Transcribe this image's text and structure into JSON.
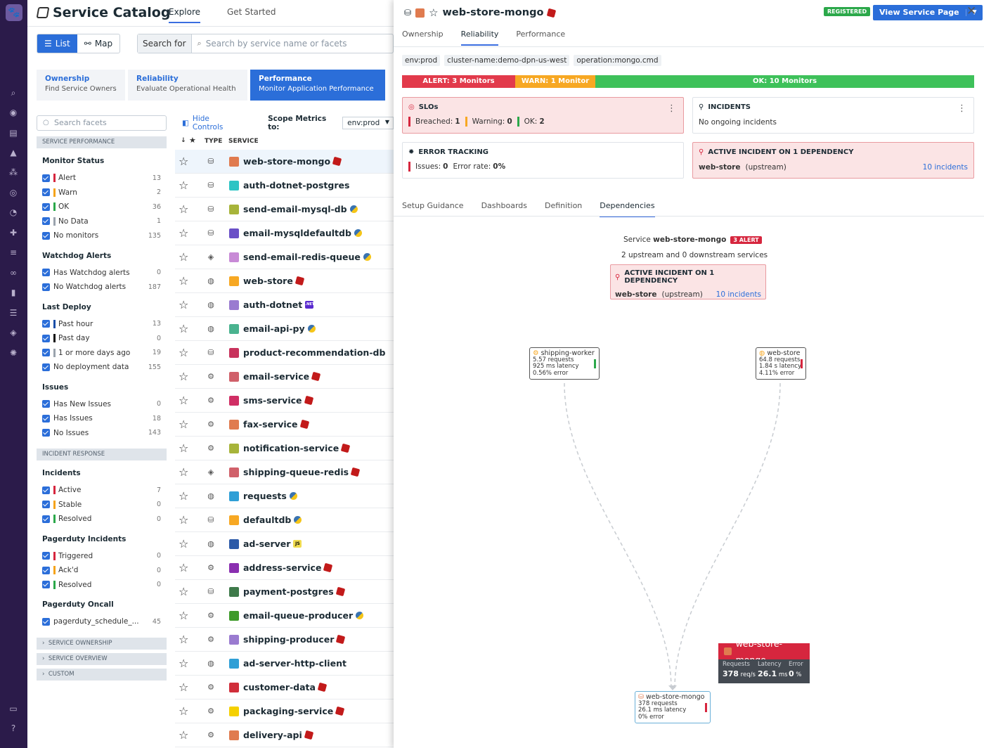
{
  "app": {
    "title": "Service Catalog",
    "tabs": [
      "Explore",
      "Get Started"
    ]
  },
  "view": {
    "list": "List",
    "map": "Map",
    "search_label": "Search for",
    "search_placeholder": "Search by service name or facets"
  },
  "cards": [
    {
      "title": "Ownership",
      "subtitle": "Find Service Owners"
    },
    {
      "title": "Reliability",
      "subtitle": "Evaluate Operational Health"
    },
    {
      "title": "Performance",
      "subtitle": "Monitor Application Performance"
    }
  ],
  "facets": {
    "search_placeholder": "Search facets",
    "section1": "Service Performance",
    "groups": [
      {
        "name": "Monitor Status",
        "items": [
          {
            "label": "Alert",
            "count": "13",
            "color": "#d6263e"
          },
          {
            "label": "Warn",
            "count": "2",
            "color": "#f5a31a"
          },
          {
            "label": "OK",
            "count": "36",
            "color": "#2ba84a"
          },
          {
            "label": "No Data",
            "count": "1",
            "color": "#9aa3ad"
          },
          {
            "label": "No monitors",
            "count": "135",
            "color": ""
          }
        ]
      },
      {
        "name": "Watchdog Alerts",
        "items": [
          {
            "label": "Has Watchdog alerts",
            "count": "0",
            "color": ""
          },
          {
            "label": "No Watchdog alerts",
            "count": "187",
            "color": ""
          }
        ]
      },
      {
        "name": "Last Deploy",
        "items": [
          {
            "label": "Past hour",
            "count": "13",
            "color": "#1a4fa8"
          },
          {
            "label": "Past day",
            "count": "0",
            "color": "#111"
          },
          {
            "label": "1 or more days ago",
            "count": "19",
            "color": "#9aa3ad"
          },
          {
            "label": "No deployment data",
            "count": "155",
            "color": ""
          }
        ]
      },
      {
        "name": "Issues",
        "items": [
          {
            "label": "Has New Issues",
            "count": "0",
            "color": ""
          },
          {
            "label": "Has Issues",
            "count": "18",
            "color": ""
          },
          {
            "label": "No Issues",
            "count": "143",
            "color": ""
          }
        ]
      }
    ],
    "section2": "Incident Response",
    "groups2": [
      {
        "name": "Incidents",
        "items": [
          {
            "label": "Active",
            "count": "7",
            "color": "#d6263e"
          },
          {
            "label": "Stable",
            "count": "0",
            "color": "#f5a31a"
          },
          {
            "label": "Resolved",
            "count": "0",
            "color": "#2ba84a"
          }
        ]
      },
      {
        "name": "Pagerduty Incidents",
        "items": [
          {
            "label": "Triggered",
            "count": "0",
            "color": "#d6263e"
          },
          {
            "label": "Ack'd",
            "count": "0",
            "color": "#f5a31a"
          },
          {
            "label": "Resolved",
            "count": "0",
            "color": "#2ba84a"
          }
        ]
      },
      {
        "name": "Pagerduty Oncall",
        "items": [
          {
            "label": "pagerduty_schedule_...",
            "count": "45",
            "color": ""
          }
        ]
      }
    ],
    "collapsed": [
      "Service Ownership",
      "Service Overview",
      "Custom"
    ]
  },
  "controls": {
    "hide": "Hide Controls",
    "scope_label": "Scope Metrics to:",
    "scope_value": "env:prod"
  },
  "table": {
    "col_type": "TYPE",
    "col_service": "SERVICE"
  },
  "services": [
    {
      "name": "web-store-mongo",
      "type": "db",
      "color": "#e07b4f",
      "lang": "ruby"
    },
    {
      "name": "auth-dotnet-postgres",
      "type": "db",
      "color": "#2ec4c4",
      "lang": ""
    },
    {
      "name": "send-email-mysql-db",
      "type": "db",
      "color": "#a7b43a",
      "lang": "py"
    },
    {
      "name": "email-mysqldefaultdb",
      "type": "db",
      "color": "#6a4fc7",
      "lang": "py"
    },
    {
      "name": "send-email-redis-queue",
      "type": "cache",
      "color": "#c88ad6",
      "lang": "py"
    },
    {
      "name": "web-store",
      "type": "web",
      "color": "#f7a823",
      "lang": "ruby"
    },
    {
      "name": "auth-dotnet",
      "type": "web",
      "color": "#9a7bd0",
      "lang": "net"
    },
    {
      "name": "email-api-py",
      "type": "web",
      "color": "#4ab38f",
      "lang": "py"
    },
    {
      "name": "product-recommendation-db",
      "type": "db",
      "color": "#c8325c",
      "lang": ""
    },
    {
      "name": "email-service",
      "type": "svc",
      "color": "#d0606a",
      "lang": "ruby"
    },
    {
      "name": "sms-service",
      "type": "svc",
      "color": "#d02e64",
      "lang": "ruby"
    },
    {
      "name": "fax-service",
      "type": "svc",
      "color": "#e07b4f",
      "lang": "ruby"
    },
    {
      "name": "notification-service",
      "type": "svc",
      "color": "#a7b43a",
      "lang": "ruby"
    },
    {
      "name": "shipping-queue-redis",
      "type": "cache",
      "color": "#d0606a",
      "lang": "ruby"
    },
    {
      "name": "requests",
      "type": "web",
      "color": "#2f9fd6",
      "lang": "py"
    },
    {
      "name": "defaultdb",
      "type": "db",
      "color": "#f7a823",
      "lang": "py"
    },
    {
      "name": "ad-server",
      "type": "web",
      "color": "#2c5aa8",
      "lang": "js"
    },
    {
      "name": "address-service",
      "type": "svc",
      "color": "#8a2fb0",
      "lang": "ruby"
    },
    {
      "name": "payment-postgres",
      "type": "db",
      "color": "#3e7a4a",
      "lang": "ruby"
    },
    {
      "name": "email-queue-producer",
      "type": "svc",
      "color": "#3e9a2a",
      "lang": "py"
    },
    {
      "name": "shipping-producer",
      "type": "svc",
      "color": "#9a7bd0",
      "lang": "ruby"
    },
    {
      "name": "ad-server-http-client",
      "type": "web",
      "color": "#2f9fd6",
      "lang": ""
    },
    {
      "name": "customer-data",
      "type": "svc",
      "color": "#d02e3a",
      "lang": "ruby"
    },
    {
      "name": "packaging-service",
      "type": "svc",
      "color": "#f5d000",
      "lang": "ruby"
    },
    {
      "name": "delivery-api",
      "type": "svc",
      "color": "#e07b4f",
      "lang": "ruby"
    }
  ],
  "detail": {
    "name": "web-store-mongo",
    "registered": "REGISTERED",
    "view_button": "View Service Page",
    "tabs": [
      "Ownership",
      "Reliability",
      "Performance"
    ],
    "tags": [
      "env:prod",
      "cluster-name:demo-dpn-us-west",
      "operation:mongo.cmd"
    ],
    "monitors": {
      "alert": "ALERT: 3 Monitors",
      "warn": "WARN: 1 Monitor",
      "ok": "OK: 10 Monitors",
      "alert_n": 3,
      "warn_n": 1,
      "ok_n": 10
    },
    "slos": {
      "title": "SLOs",
      "breached_label": "Breached:",
      "breached": "1",
      "warning_label": "Warning:",
      "warning": "0",
      "ok_label": "OK:",
      "ok": "2"
    },
    "incidents": {
      "title": "INCIDENTS",
      "text": "No ongoing incidents"
    },
    "errors": {
      "title": "ERROR TRACKING",
      "issues_label": "Issues:",
      "issues": "0",
      "rate_label": "Error rate:",
      "rate": "0%"
    },
    "dep": {
      "title": "ACTIVE INCIDENT ON 1 DEPENDENCY",
      "service": "web-store",
      "relation": "(upstream)",
      "link": "10 incidents"
    },
    "subtabs": [
      "Setup Guidance",
      "Dashboards",
      "Definition",
      "Dependencies"
    ],
    "graph": {
      "service_label": "Service",
      "service": "web-store-mongo",
      "alert": "3 ALERT",
      "summary": "2 upstream and 0 downstream services",
      "nodes": [
        {
          "name": "shipping-worker",
          "l1": "5.57 requests",
          "l2": "925 ms latency",
          "l3": "0.56% error",
          "status": "#2ba84a"
        },
        {
          "name": "web-store",
          "l1": "64.8 requests",
          "l2": "1.84 s latency",
          "l3": "4.11% error",
          "status": "#d6263e"
        },
        {
          "name": "web-store-mongo",
          "l1": "378 requests",
          "l2": "26.1 ms latency",
          "l3": "0% error",
          "status": "#d6263e"
        }
      ],
      "tooltip": {
        "name": "web-store-mongo",
        "req_label": "Requests",
        "lat_label": "Latency",
        "err_label": "Error",
        "req": "378",
        "req_unit": "req/s",
        "lat": "26.1",
        "lat_unit": "ms",
        "err": "0",
        "err_unit": "%"
      }
    }
  }
}
